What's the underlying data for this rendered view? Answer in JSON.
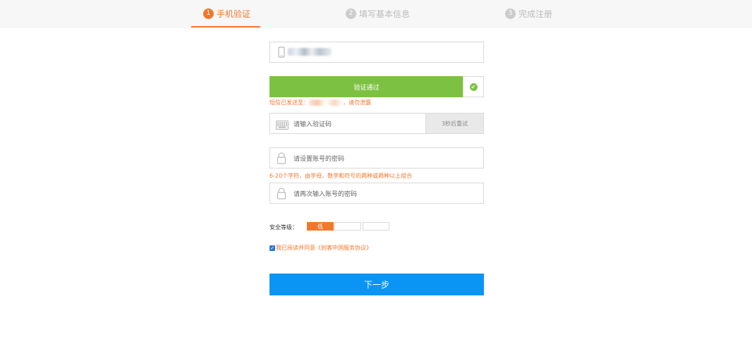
{
  "steps": [
    {
      "number": "1",
      "label": "手机验证"
    },
    {
      "number": "2",
      "label": "填写基本信息"
    },
    {
      "number": "3",
      "label": "完成注册"
    }
  ],
  "verify": {
    "status_label": "验证通过"
  },
  "sms_note": {
    "prefix": "短信已发送至：",
    "suffix": "，请勿泄露"
  },
  "code_input": {
    "placeholder": "请输入验证码",
    "retry_label": "3秒后重试"
  },
  "password": {
    "placeholder": "请设置账号的密码",
    "hint": "6-20个字符，由字母，数字和符号的两种或两种以上组合",
    "confirm_placeholder": "请再次输入账号的密码"
  },
  "strength": {
    "label": "安全等级：",
    "level": "低",
    "filled_segments": 1,
    "total_segments": 3
  },
  "agreement": {
    "text": "我已阅读并同意《创客中国服务协议》",
    "checked": true
  },
  "next_button": "下一步",
  "colors": {
    "accent": "#f0782c",
    "success": "#7dc142",
    "primary": "#0a95f5"
  }
}
